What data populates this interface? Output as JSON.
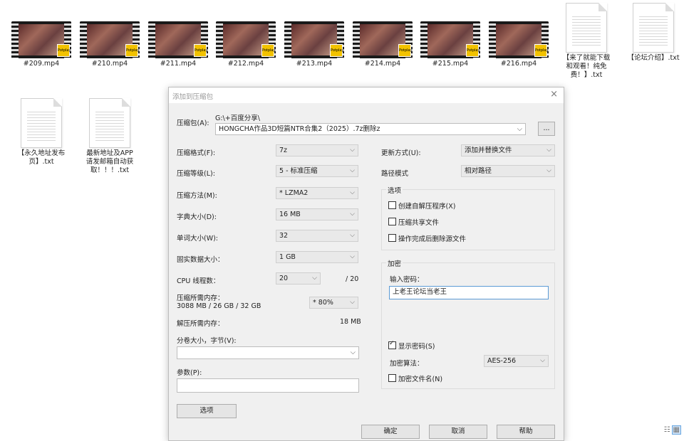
{
  "files": {
    "videos": [
      {
        "name": "#209.mp4",
        "badge": "Potplayer"
      },
      {
        "name": "#210.mp4",
        "badge": "Potplayer"
      },
      {
        "name": "#211.mp4",
        "badge": "Potplayer"
      },
      {
        "name": "#212.mp4",
        "badge": "Potplayer"
      },
      {
        "name": "#213.mp4",
        "badge": "Potplayer"
      },
      {
        "name": "#214.mp4",
        "badge": "Potplayer"
      },
      {
        "name": "#215.mp4",
        "badge": "Potplayer"
      },
      {
        "name": "#216.mp4",
        "badge": "Potplayer"
      }
    ],
    "docs": [
      {
        "line1": "【来了就能下载",
        "line2": "和观看！纯免",
        "line3": "费！】.txt"
      },
      {
        "line1": "【论坛介绍】.txt",
        "line2": "",
        "line3": ""
      },
      {
        "line1": "【永久地址发布",
        "line2": "页】.txt",
        "line3": ""
      },
      {
        "line1": "最新地址及APP",
        "line2": "请发邮箱自动获",
        "line3": "取！！！.txt"
      }
    ]
  },
  "dialog": {
    "title": "添加到压缩包",
    "close": "×",
    "archive_label": "压缩包(A):",
    "archive_path": "G:\\+百度分享\\",
    "archive_name": "HONGCHA作品3D短篇NTR合集2（2025）.7z删除z",
    "browse": "...",
    "format_label": "压缩格式(F):",
    "format_value": "7z",
    "level_label": "压缩等级(L):",
    "level_value": "5 - 标准压缩",
    "method_label": "压缩方法(M):",
    "method_value": "* LZMA2",
    "dict_label": "字典大小(D):",
    "dict_value": "16 MB",
    "word_label": "单词大小(W):",
    "word_value": "32",
    "solid_label": "固实数据大小：",
    "solid_value": "1 GB",
    "cpu_label": "CPU 线程数：",
    "cpu_value": "20",
    "cpu_max": "/ 20",
    "mem_label": "压缩所需内存：",
    "mem_detail": "3088 MB / 26 GB / 32 GB",
    "mem_value": "* 80%",
    "decomp_label": "解压所需内存：",
    "decomp_value": "18 MB",
    "split_label": "分卷大小，字节(V):",
    "split_value": "",
    "params_label": "参数(P):",
    "params_value": "",
    "options_button": "选项",
    "update_label": "更新方式(U):",
    "update_value": "添加并替换文件",
    "path_label": "路径模式",
    "path_value": "相对路径",
    "options_group": "选项",
    "opt_sfx": "创建自解压程序(X)",
    "opt_shared": "压缩共享文件",
    "opt_delete": "操作完成后删除源文件",
    "encryption_group": "加密",
    "password_label": "输入密码：",
    "password_value": "上老王论坛当老王",
    "show_password": "显示密码(S)",
    "enc_method_label": "加密算法：",
    "enc_method_value": "AES-256",
    "encrypt_names": "加密文件名(N)",
    "ok": "确定",
    "cancel": "取消",
    "help": "帮助"
  }
}
